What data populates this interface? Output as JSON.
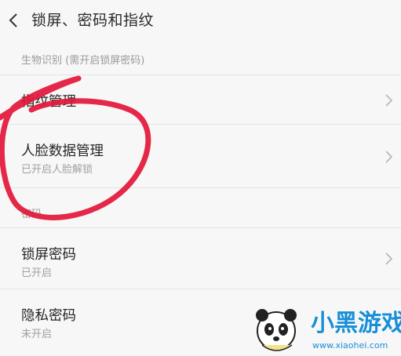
{
  "header": {
    "title": "锁屏、密码和指纹"
  },
  "sections": {
    "biometrics_header": "生物识别 (需开启锁屏密码)",
    "password_header": "密码"
  },
  "rows": {
    "fingerprint": {
      "label": "指纹管理"
    },
    "face": {
      "label": "人脸数据管理",
      "status": "已开启人脸解锁"
    },
    "lockscreen": {
      "label": "锁屏密码",
      "status": "已开启"
    },
    "privacy": {
      "label": "隐私密码",
      "status": "未开启"
    }
  },
  "colors": {
    "annotation": "#e3163a",
    "background": "#f7f7f7",
    "watermark": "#1a8fd6"
  },
  "icons": {
    "back": "chevron-left-icon",
    "row_arrow": "chevron-right-icon"
  },
  "watermark": {
    "brand": "小黑游戏",
    "url": "www.xiaohei.com"
  }
}
